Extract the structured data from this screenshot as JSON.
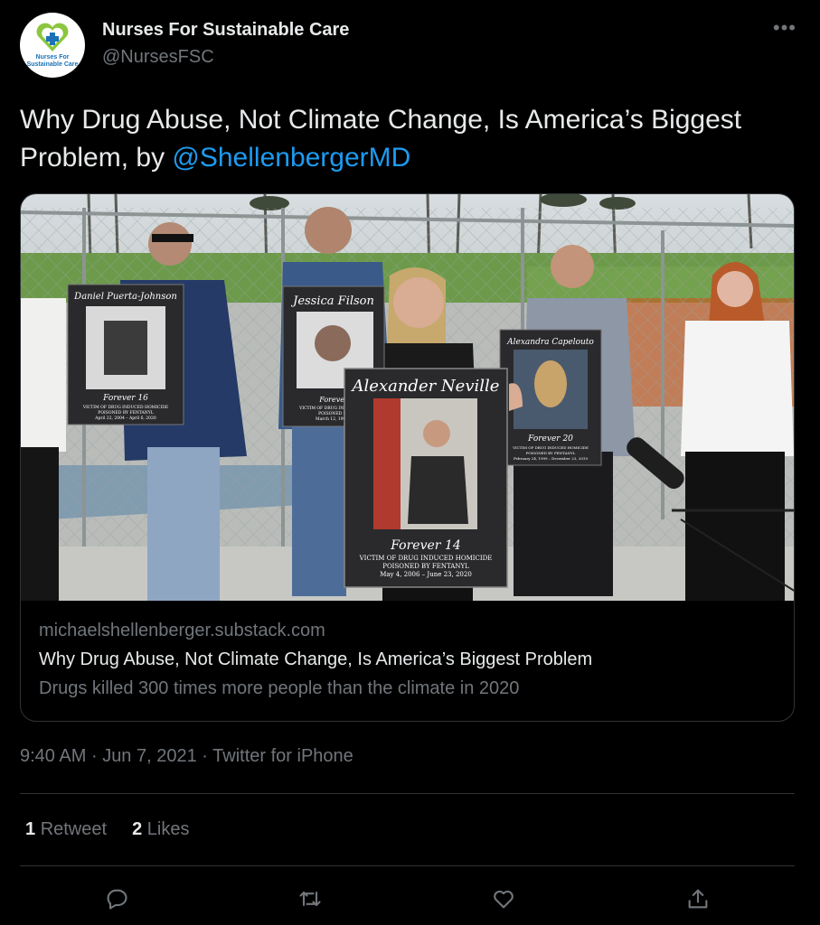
{
  "author": {
    "name": "Nurses For Sustainable Care",
    "handle": "@NursesFSC",
    "avatar_text": "Nurses For Sustainable Care",
    "avatar_icon": "heart-cross-logo"
  },
  "tweet": {
    "text": "Why Drug Abuse, Not Climate Change, Is America’s Biggest Problem, by ",
    "mention": "@ShellenbergerMD"
  },
  "card": {
    "domain": "michaelshellenberger.substack.com",
    "title": "Why Drug Abuse, Not Climate Change, Is America’s Biggest Problem",
    "description": "Drugs killed 300 times more people than the climate in 2020",
    "image": {
      "sign_left": {
        "name": "Daniel Puerta-Johnson",
        "forever": "Forever 16",
        "line1": "VICTIM OF DRUG INDUCED HOMICIDE",
        "line2": "POISONED BY FENTANYL",
        "dates": "April 22, 2004 – April 6, 2020"
      },
      "sign_mid_back": {
        "name": "Jessica Filson",
        "forever": "Forever",
        "line1": "VICTIM OF DRUG INDUCED HO",
        "line2": "POISONED BY",
        "dates": "March 12, 1990 –"
      },
      "sign_center": {
        "name": "Alexander Neville",
        "forever": "Forever 14",
        "line1": "VICTIM OF DRUG INDUCED HOMICIDE",
        "line2": "POISONED BY FENTANYL",
        "dates": "May 4, 2006 – June 23, 2020"
      },
      "sign_right": {
        "name": "Alexandra Capelouto",
        "forever": "Forever 20",
        "line1": "VICTIM OF DRUG INDUCED HOMICIDE",
        "line2": "POISONED BY FENTANYL",
        "dates": "February 24, 1999 – December 23, 2019"
      }
    }
  },
  "meta": {
    "time": "9:40 AM",
    "date": "Jun 7, 2021",
    "source": "Twitter for iPhone",
    "separator": "·"
  },
  "stats": {
    "retweets_count": "1",
    "retweets_label": "Retweet",
    "likes_count": "2",
    "likes_label": "Likes"
  },
  "actions": [
    "reply-icon",
    "retweet-icon",
    "like-icon",
    "share-icon"
  ],
  "colors": {
    "accent": "#1d9bf0",
    "text": "#e7e9ea",
    "muted": "#71767b",
    "border": "#2f3336",
    "background": "#000000"
  }
}
